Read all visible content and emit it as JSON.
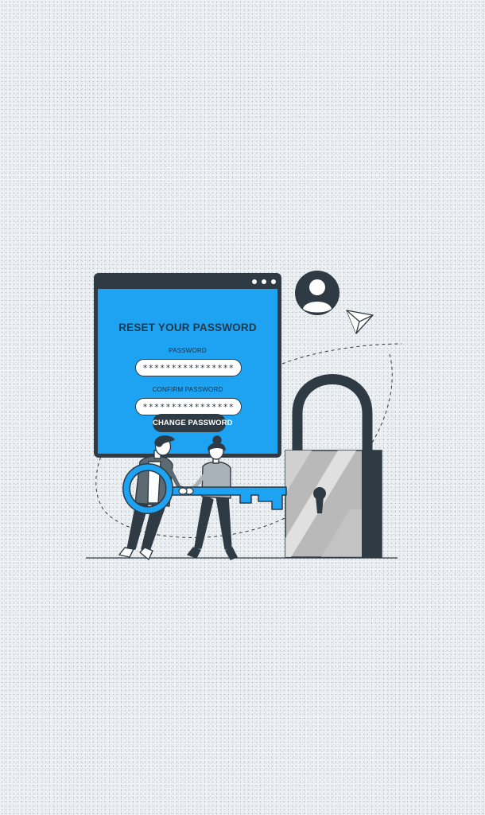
{
  "reset_form": {
    "title": "RESET YOUR PASSWORD",
    "password_label": "PASSWORD",
    "password_value": "****************",
    "confirm_label": "CONFIRM PASSWORD",
    "confirm_value": "****************",
    "submit_label": "CHANGE PASSWORD"
  },
  "icons": {
    "user": "user-avatar-icon",
    "paper_plane": "paper-plane-icon",
    "padlock": "padlock-icon",
    "key": "key-icon"
  },
  "colors": {
    "accent": "#1ea3f3",
    "dark": "#2f3b44",
    "background": "#eef2f5",
    "lock_body": "#b9b9b9"
  }
}
